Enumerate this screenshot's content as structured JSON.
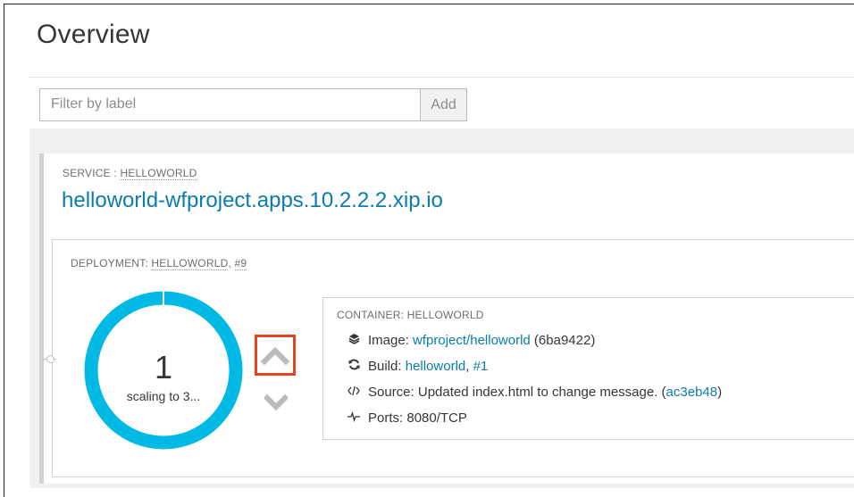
{
  "page": {
    "title": "Overview"
  },
  "filter": {
    "placeholder": "Filter by label",
    "add_label": "Add"
  },
  "service": {
    "header_prefix": "SERVICE : ",
    "name": "HELLOWORLD",
    "url": "helloworld-wfproject.apps.10.2.2.2.xip.io"
  },
  "deployment": {
    "header_prefix": "DEPLOYMENT: ",
    "name": "HELLOWORLD",
    "separator": ", ",
    "revision": "#9",
    "pod_count": "1",
    "pod_status": "scaling to 3...",
    "donut_color": "#00b9e4"
  },
  "container": {
    "header": "CONTAINER: HELLOWORLD",
    "image_label": "Image: ",
    "image_link": "wfproject/helloworld",
    "image_hash": " (6ba9422)",
    "build_label": "Build: ",
    "build_link": "helloworld",
    "build_sep": ", ",
    "build_num": "#1",
    "source_label": "Source: ",
    "source_text": "Updated index.html to change message. (",
    "source_commit": "ac3eb48",
    "source_close": ")",
    "ports_label": "Ports: ",
    "ports_value": "8080/TCP"
  },
  "icons": {
    "image": "layers-icon",
    "build": "refresh-icon",
    "source": "code-icon",
    "ports": "pulse-icon",
    "scale_up": "chevron-up-icon",
    "scale_down": "chevron-down-icon"
  },
  "colors": {
    "accent": "#0b7cad",
    "highlight": "#e7431f"
  }
}
